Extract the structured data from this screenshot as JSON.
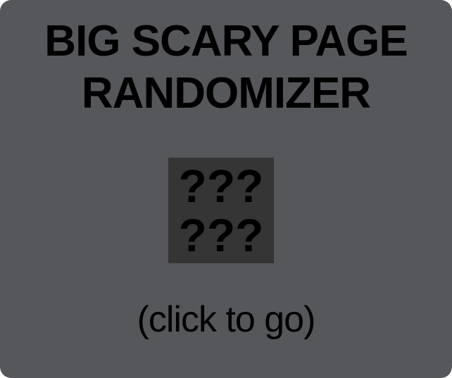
{
  "title": {
    "line1": "BIG SCARY PAGE",
    "line2": "RANDOMIZER"
  },
  "mystery": {
    "line1": "???",
    "line2": "???"
  },
  "cta_label": "(click to go)",
  "colors": {
    "panel": "#56575b",
    "box": "#353535",
    "text": "#000000"
  }
}
